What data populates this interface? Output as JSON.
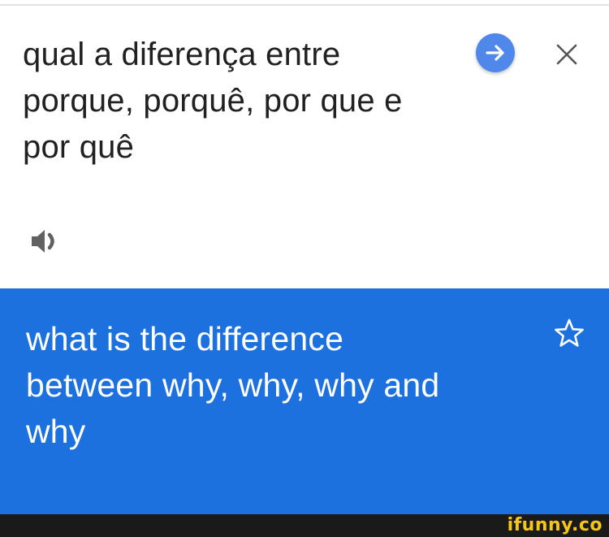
{
  "source": {
    "text": "qual a diferença entre\nporque, porquê, por que e\npor quê",
    "go_icon": "arrow-right-icon",
    "close_icon": "close-icon",
    "speaker_icon": "speaker-icon"
  },
  "result": {
    "text": "what is the difference\nbetween why, why, why and\nwhy",
    "star_icon": "star-outline-icon"
  },
  "watermark": {
    "text": "ifunny.co"
  },
  "colors": {
    "result_background": "#1d71df",
    "go_button": "#4f88ea",
    "watermark": "#f5c518"
  }
}
